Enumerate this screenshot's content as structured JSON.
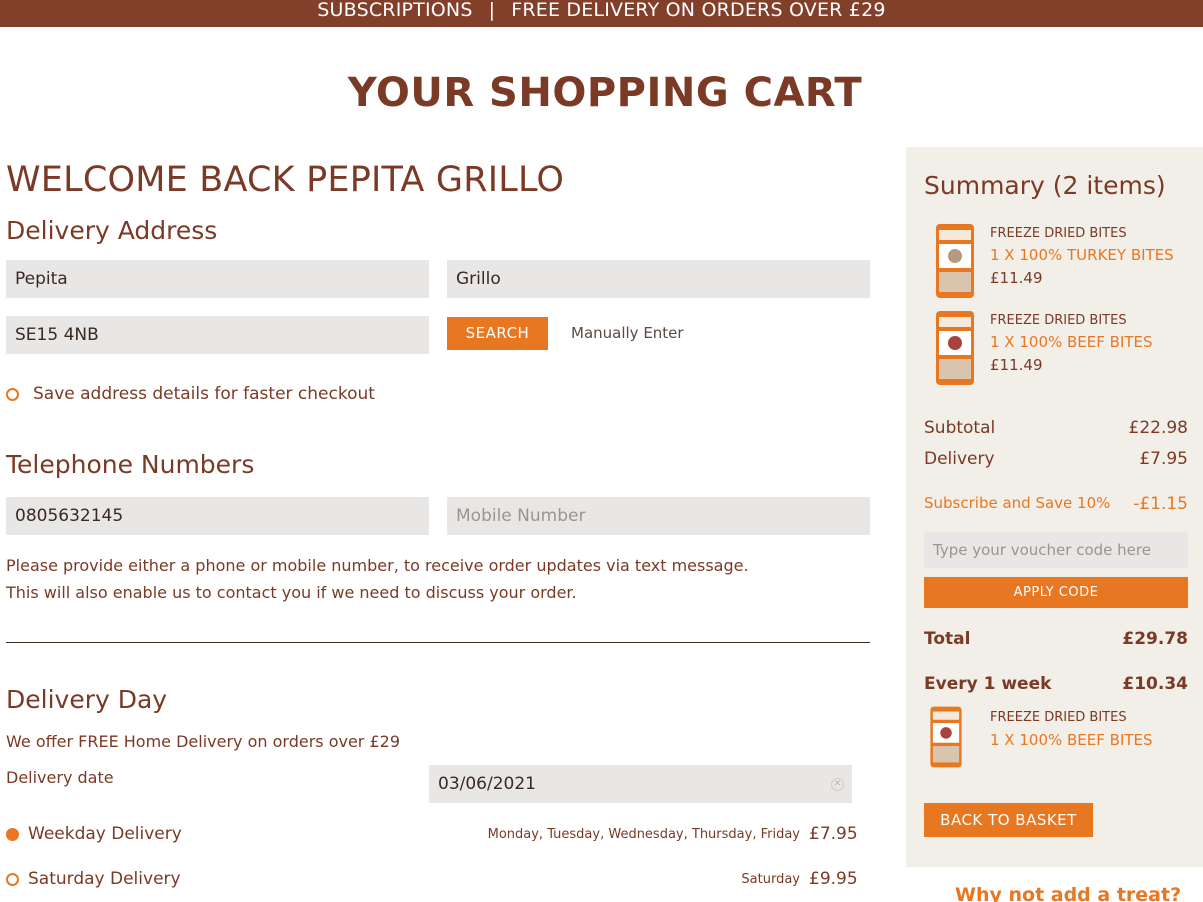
{
  "banner": {
    "left": "SUBSCRIPTIONS",
    "separator": "|",
    "right": "FREE DELIVERY ON ORDERS OVER £29"
  },
  "page_title": "YOUR SHOPPING CART",
  "welcome": "WELCOME BACK PEPITA GRILLO",
  "delivery_address": {
    "heading": "Delivery Address",
    "first_name": "Pepita",
    "last_name": "Grillo",
    "postcode": "SE15 4NB",
    "search_label": "SEARCH",
    "manual_label": "Manually Enter",
    "save_label": "Save address details for faster checkout"
  },
  "telephone": {
    "heading": "Telephone Numbers",
    "phone": "0805632145",
    "mobile_placeholder": "Mobile Number",
    "note_line1": "Please provide either a phone or mobile number, to receive order updates via text message.",
    "note_line2": "This will also enable us to contact you if we need to discuss your order."
  },
  "delivery_day": {
    "heading": "Delivery Day",
    "free_note": "We offer FREE Home Delivery on orders over £29",
    "date_label": "Delivery date",
    "date_value": "03/06/2021",
    "options": [
      {
        "label": "Weekday Delivery",
        "days": "Monday, Tuesday, Wednesday, Thursday, Friday",
        "price": "£7.95",
        "selected": true
      },
      {
        "label": "Saturday Delivery",
        "days": "Saturday",
        "price": "£9.95",
        "selected": false
      }
    ]
  },
  "summary": {
    "title": "Summary (2 items)",
    "items": [
      {
        "category": "FREEZE DRIED BITES",
        "name": "1 X 100% TURKEY BITES",
        "price": "£11.49"
      },
      {
        "category": "FREEZE DRIED BITES",
        "name": "1 X 100% BEEF BITES",
        "price": "£11.49"
      }
    ],
    "subtotal_label": "Subtotal",
    "subtotal_value": "£22.98",
    "delivery_label": "Delivery",
    "delivery_value": "£7.95",
    "discount_label": "Subscribe and Save 10%",
    "discount_value": "-£1.15",
    "voucher_placeholder": "Type your voucher code here",
    "apply_label": "APPLY CODE",
    "total_label": "Total",
    "total_value": "£29.78",
    "every_label": "Every 1 week",
    "every_value": "£10.34",
    "sub_item": {
      "category": "FREEZE DRIED BITES",
      "name": "1 X 100% BEEF BITES"
    },
    "back_label": "BACK TO BASKET"
  },
  "treat_heading": "Why not add a treat?",
  "colors": {
    "brown": "#82402a",
    "orange": "#e87722",
    "summary_bg": "#f2efe8",
    "field_bg": "#e9e7e6"
  }
}
